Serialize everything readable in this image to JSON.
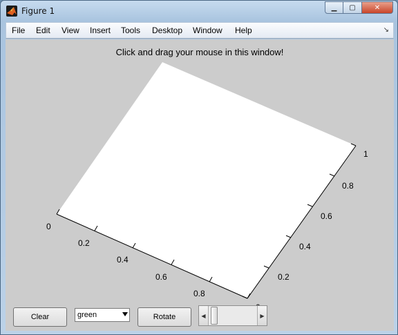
{
  "window": {
    "title": "Figure 1",
    "icon": "matlab-icon"
  },
  "menu": [
    {
      "label": "File"
    },
    {
      "label": "Edit"
    },
    {
      "label": "View"
    },
    {
      "label": "Insert"
    },
    {
      "label": "Tools"
    },
    {
      "label": "Desktop"
    },
    {
      "label": "Window"
    },
    {
      "label": "Help"
    }
  ],
  "figure": {
    "title": "Click and drag your mouse in this window!",
    "background": "#cccccc",
    "axes_face": "#ffffff",
    "x_ticks": [
      "0",
      "0.2",
      "0.4",
      "0.6",
      "0.8"
    ],
    "y_ticks": [
      "0",
      "0.2",
      "0.4",
      "0.6",
      "0.8",
      "1"
    ]
  },
  "controls": {
    "clear_label": "Clear",
    "color_select_value": "green",
    "rotate_label": "Rotate",
    "slider_value": 0.05
  }
}
